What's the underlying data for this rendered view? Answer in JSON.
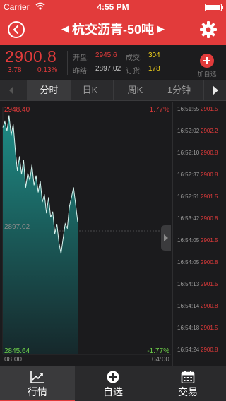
{
  "status_bar": {
    "carrier": "Carrier",
    "time": "4:55 PM",
    "battery_level": 1.0
  },
  "nav": {
    "title": "杭交沥青-50吨",
    "back_icon": "back-circle-icon",
    "settings_icon": "gear-icon"
  },
  "quote": {
    "price": "2900.8",
    "change": "3.78",
    "change_pct": "0.13%",
    "open_label": "开盘:",
    "open_value": "2945.6",
    "volume_label": "成交:",
    "volume_value": "304",
    "prev_close_label": "昨结:",
    "prev_close_value": "2897.02",
    "order_label": "订货:",
    "order_value": "178",
    "add_fav_label": "加自选"
  },
  "tabs": [
    {
      "label": "分时",
      "active": true
    },
    {
      "label": "日K",
      "active": false
    },
    {
      "label": "周K",
      "active": false
    },
    {
      "label": "1分钟",
      "active": false
    }
  ],
  "chart_data": {
    "type": "area",
    "ylim": [
      2845.64,
      2948.4
    ],
    "y_top_label": "2948.40",
    "y_mid_label": "2897.02",
    "y_bottom_label": "2845.64",
    "pct_top_label": "1.77%",
    "pct_bottom_label": "-1.77%",
    "x_start_label": "08:00",
    "x_end_label": "04:00",
    "series": [
      {
        "values": [
          2940.0,
          2942.5,
          2938.5,
          2945.0,
          2936.8,
          2941.4,
          2930.5,
          2922.0,
          2928.0,
          2920.5,
          2926.5,
          2915.0,
          2921.0,
          2918.0,
          2924.5,
          2916.0,
          2920.0,
          2913.0,
          2917.8,
          2909.0,
          2912.2,
          2904.3,
          2911.0,
          2902.6,
          2905.0,
          2895.8,
          2899.9,
          2892.0,
          2887.5,
          2894.0,
          2900.0,
          2898.1,
          2907.0,
          2911.0,
          2915.1,
          2908.0,
          2900.8
        ]
      }
    ],
    "colors": {
      "line": "#d8f5f0",
      "fill_top": "#1e8c86",
      "fill_bottom": "#16282b",
      "mid_line": "#4a4a4c"
    }
  },
  "ticks": [
    {
      "time": "16:51:55",
      "price": "2901.5"
    },
    {
      "time": "16:52:02",
      "price": "2902.2"
    },
    {
      "time": "16:52:10",
      "price": "2900.8"
    },
    {
      "time": "16:52:37",
      "price": "2900.8"
    },
    {
      "time": "16:52:51",
      "price": "2901.5"
    },
    {
      "time": "16:53:42",
      "price": "2900.8"
    },
    {
      "time": "16:54:05",
      "price": "2901.5"
    },
    {
      "time": "16:54:05",
      "price": "2900.8"
    },
    {
      "time": "16:54:13",
      "price": "2901.5"
    },
    {
      "time": "16:54:14",
      "price": "2900.8"
    },
    {
      "time": "16:54:18",
      "price": "2901.5"
    },
    {
      "time": "16:54:24",
      "price": "2900.8"
    }
  ],
  "bottom_tabs": [
    {
      "label": "行情",
      "icon": "chart-trend-icon",
      "active": true
    },
    {
      "label": "自选",
      "icon": "plus-circle-icon",
      "active": false
    },
    {
      "label": "交易",
      "icon": "calendar-icon",
      "active": false
    }
  ],
  "colors": {
    "accent": "#e23b3b",
    "yellow": "#f2d21b",
    "green": "#6ecf4a",
    "background": "#1b1b1d"
  }
}
